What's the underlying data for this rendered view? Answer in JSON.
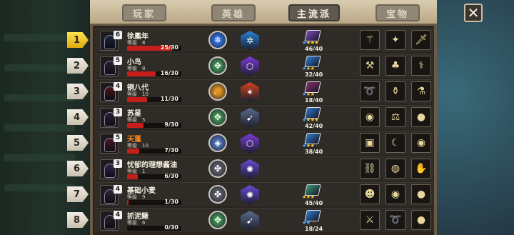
{
  "tabs": [
    {
      "label": "玩家",
      "active": false
    },
    {
      "label": "英雄",
      "active": false
    },
    {
      "label": "主流派",
      "active": true
    },
    {
      "label": "宝物",
      "active": false
    }
  ],
  "close_label": "✕",
  "level_prefix": "等级",
  "players": [
    {
      "rank": "1",
      "stars": "6",
      "name": "徐鳳年",
      "level": "8",
      "hp": "25/30",
      "hp_frac": 0.83,
      "name_color": "white",
      "portrait": "#1b2740",
      "round_skill": "#2f6bd6",
      "round_icon": "❄",
      "hex_skill": "#2b7fd6",
      "hex_icon": "✲",
      "book": "#7c4ab8",
      "book_stars": [
        "blue",
        "gold",
        "gold",
        "gold"
      ],
      "count": "46/40",
      "items": [
        "⚚",
        "✦",
        "🗡",
        "☾"
      ]
    },
    {
      "rank": "2",
      "stars": "5",
      "name": "小鸟",
      "level": "8",
      "hp": "16/30",
      "hp_frac": 0.53,
      "name_color": "white",
      "portrait": "#2a2032",
      "round_skill": "#3f8a4f",
      "round_icon": "✥",
      "hex_skill": "#7b3ad6",
      "hex_icon": "⬡",
      "book": "#2d7bd0",
      "book_stars": [
        "blue",
        "gold",
        "gold"
      ],
      "count": "32/40",
      "items": [
        "⚒",
        "♣",
        "⚕",
        ""
      ]
    },
    {
      "rank": "3",
      "stars": "4",
      "name": "铜八代",
      "level": "10",
      "hp": "11/30",
      "hp_frac": 0.37,
      "name_color": "white",
      "portrait": "#4a1518",
      "round_skill": "#d58a1c",
      "round_icon": "☄",
      "hex_skill": "#d5421c",
      "hex_icon": "✶",
      "book": "#8a2f6b",
      "book_stars": [
        "blue",
        "gold",
        "gold"
      ],
      "count": "18/40",
      "items": [
        "➰",
        "⚱",
        "⚗",
        ""
      ]
    },
    {
      "rank": "4",
      "stars": "3",
      "name": "苏星",
      "level": "5",
      "hp": "9/30",
      "hp_frac": 0.3,
      "name_color": "white",
      "portrait": "#26223a",
      "round_skill": "#3f8a4f",
      "round_icon": "✥",
      "hex_skill": "#5a6b8a",
      "hex_icon": "➹",
      "book": "#2d7bd0",
      "book_stars": [
        "blue",
        "gold",
        "gold",
        "gold"
      ],
      "count": "42/40",
      "items": [
        "◉",
        "⚖",
        "●",
        ""
      ]
    },
    {
      "rank": "5",
      "stars": "5",
      "name": "天蓬",
      "level": "10",
      "hp": "7/30",
      "hp_frac": 0.23,
      "name_color": "orange",
      "portrait": "#4a1a20",
      "round_skill": "#4a6fb0",
      "round_icon": "◈",
      "hex_skill": "#7b3ad6",
      "hex_icon": "⬡",
      "book": "#2d7bd0",
      "book_stars": [
        "blue",
        "gold",
        "gold"
      ],
      "count": "38/40",
      "items": [
        "▣",
        "☾",
        "◉",
        ""
      ]
    },
    {
      "rank": "6",
      "stars": "3",
      "name": "忧郁的理想酱油",
      "level": "1",
      "hp": "6/30",
      "hp_frac": 0.2,
      "name_color": "white",
      "portrait": "#3a2050",
      "round_skill": "#5b5b66",
      "round_icon": "✤",
      "hex_skill": "#6b4ad6",
      "hex_icon": "✺",
      "book": "",
      "book_stars": [],
      "count": "",
      "items": [
        "⛓",
        "◍",
        "✋",
        ""
      ]
    },
    {
      "rank": "7",
      "stars": "4",
      "name": "基础小麦",
      "level": "9",
      "hp": "1/30",
      "hp_frac": 0.03,
      "name_color": "white",
      "portrait": "#2c2a38",
      "round_skill": "#5b5b66",
      "round_icon": "✤",
      "hex_skill": "#6b4ad6",
      "hex_icon": "✺",
      "book": "#3a9a7a",
      "book_stars": [
        "gold",
        "gold",
        "gold"
      ],
      "count": "45/40",
      "items": [
        "☻",
        "◉",
        "●",
        ""
      ]
    },
    {
      "rank": "8",
      "stars": "4",
      "name": "抓泥鳅",
      "level": "6",
      "hp": "0/30",
      "hp_frac": 0.0,
      "name_color": "white",
      "portrait": "#22222a",
      "round_skill": "#3f8a4f",
      "round_icon": "✥",
      "hex_skill": "#5a6b8a",
      "hex_icon": "➹",
      "book": "#2d7bd0",
      "book_stars": [
        "blue",
        "blue"
      ],
      "count": "18/24",
      "items": [
        "⚔",
        "➰",
        "●",
        ""
      ]
    }
  ]
}
